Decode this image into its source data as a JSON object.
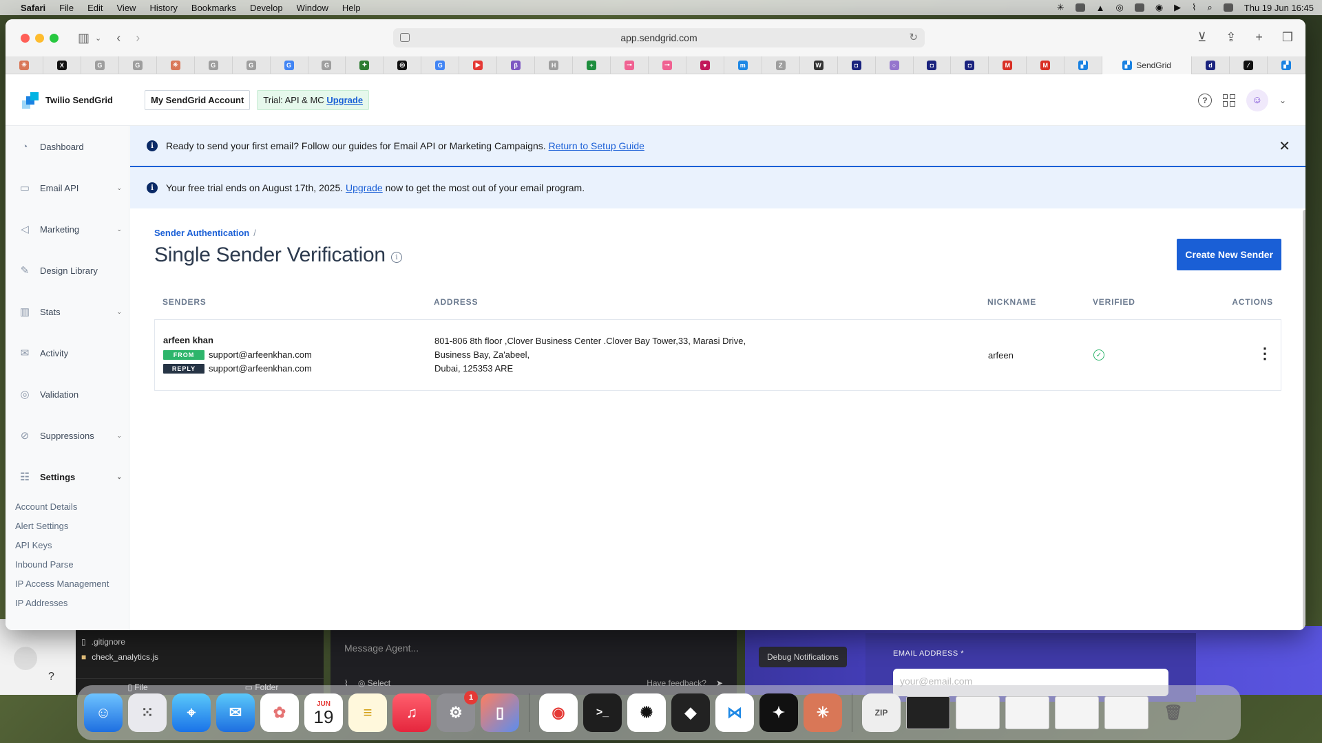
{
  "menubar": {
    "app": "Safari",
    "items": [
      "File",
      "Edit",
      "View",
      "History",
      "Bookmarks",
      "Develop",
      "Window",
      "Help"
    ],
    "clock": "Thu 19 Jun  16:45"
  },
  "browser": {
    "url": "app.sendgrid.com",
    "active_tab": "SendGrid",
    "favicons": [
      {
        "name": "claude-favicon",
        "color": "#d97757",
        "glyph": "✳"
      },
      {
        "name": "x-favicon",
        "color": "#111111",
        "glyph": "X"
      },
      {
        "name": "generic-favicon-1",
        "color": "#9e9e9e",
        "glyph": "G"
      },
      {
        "name": "generic-favicon-2",
        "color": "#9e9e9e",
        "glyph": "G"
      },
      {
        "name": "claude-favicon-2",
        "color": "#d97757",
        "glyph": "✳"
      },
      {
        "name": "generic-favicon-3",
        "color": "#9e9e9e",
        "glyph": "G"
      },
      {
        "name": "generic-favicon-4",
        "color": "#9e9e9e",
        "glyph": "G"
      },
      {
        "name": "google-favicon",
        "color": "#4285f4",
        "glyph": "G"
      },
      {
        "name": "generic-favicon-5",
        "color": "#9e9e9e",
        "glyph": "G"
      },
      {
        "name": "leaf-favicon",
        "color": "#2e7d32",
        "glyph": "✦"
      },
      {
        "name": "openai-favicon",
        "color": "#111111",
        "glyph": "◎"
      },
      {
        "name": "google-favicon-2",
        "color": "#4285f4",
        "glyph": "G"
      },
      {
        "name": "youtube-favicon",
        "color": "#e53935",
        "glyph": "▶"
      },
      {
        "name": "purple-favicon",
        "color": "#7e57c2",
        "glyph": "β"
      },
      {
        "name": "h-favicon",
        "color": "#9e9e9e",
        "glyph": "H"
      },
      {
        "name": "sheets-favicon",
        "color": "#1e8e3e",
        "glyph": "+"
      },
      {
        "name": "git-favicon-1",
        "color": "#f06292",
        "glyph": "⊸"
      },
      {
        "name": "git-favicon-2",
        "color": "#f06292",
        "glyph": "⊸"
      },
      {
        "name": "heart-favicon",
        "color": "#c2185b",
        "glyph": "♥"
      },
      {
        "name": "m-favicon",
        "color": "#1e88e5",
        "glyph": "m"
      },
      {
        "name": "z-favicon",
        "color": "#9e9e9e",
        "glyph": "Z"
      },
      {
        "name": "w-favicon",
        "color": "#333333",
        "glyph": "W"
      },
      {
        "name": "dark-favicon-1",
        "color": "#1a237e",
        "glyph": "◘"
      },
      {
        "name": "circle-favicon",
        "color": "#9575cd",
        "glyph": "○"
      },
      {
        "name": "dark-favicon-2",
        "color": "#1a237e",
        "glyph": "◘"
      },
      {
        "name": "dark-favicon-3",
        "color": "#1a237e",
        "glyph": "◘"
      },
      {
        "name": "gmail-favicon-1",
        "color": "#d93025",
        "glyph": "M"
      },
      {
        "name": "gmail-favicon-2",
        "color": "#d93025",
        "glyph": "M"
      },
      {
        "name": "sendgrid-favicon",
        "color": "#1a82e2",
        "glyph": "▞"
      }
    ],
    "after_tabs": [
      {
        "name": "d-favicon",
        "color": "#1a237e",
        "glyph": "d"
      },
      {
        "name": "slash-favicon",
        "color": "#111111",
        "glyph": "⁄"
      },
      {
        "name": "sendgrid-favicon-2",
        "color": "#1a82e2",
        "glyph": "▞"
      }
    ]
  },
  "app": {
    "brand": "Twilio SendGrid",
    "account_button": "My SendGrid Account",
    "trial_prefix": "Trial:",
    "trial_plan": "API & MC",
    "trial_upgrade": "Upgrade",
    "sidebar": {
      "items": [
        {
          "label": "Dashboard",
          "icon": "dashboard-icon",
          "glyph": "◔",
          "has_caret": false
        },
        {
          "label": "Email API",
          "icon": "email-api-icon",
          "glyph": "▭",
          "has_caret": true
        },
        {
          "label": "Marketing",
          "icon": "megaphone-icon",
          "glyph": "◁",
          "has_caret": true
        },
        {
          "label": "Design Library",
          "icon": "design-icon",
          "glyph": "✎",
          "has_caret": false
        },
        {
          "label": "Stats",
          "icon": "stats-icon",
          "glyph": "▥",
          "has_caret": true
        },
        {
          "label": "Activity",
          "icon": "activity-icon",
          "glyph": "✉",
          "has_caret": false
        },
        {
          "label": "Validation",
          "icon": "validation-icon",
          "glyph": "◎",
          "has_caret": false
        },
        {
          "label": "Suppressions",
          "icon": "suppressions-icon",
          "glyph": "⊘",
          "has_caret": true
        },
        {
          "label": "Settings",
          "icon": "settings-icon",
          "glyph": "☷",
          "has_caret": true
        }
      ],
      "settings_sub": [
        "Account Details",
        "Alert Settings",
        "API Keys",
        "Inbound Parse",
        "IP Access Management",
        "IP Addresses"
      ]
    },
    "banner_setup": {
      "text": "Ready to send your first email? Follow our guides for Email API or Marketing Campaigns.",
      "link": "Return to Setup Guide"
    },
    "banner_trial": {
      "before": "Your free trial ends on August 17th, 2025.",
      "link": "Upgrade",
      "after": "now to get the most out of your email program."
    },
    "breadcrumb": "Sender Authentication",
    "page_title": "Single Sender Verification",
    "create_button": "Create New Sender",
    "table": {
      "headers": [
        "SENDERS",
        "ADDRESS",
        "NICKNAME",
        "VERIFIED",
        "ACTIONS"
      ],
      "rows": [
        {
          "name": "arfeen khan",
          "from_label": "FROM",
          "from_email": "support@arfeenkhan.com",
          "reply_label": "REPLY",
          "reply_email": "support@arfeenkhan.com",
          "address_line1": "801-806 8th floor ,Clover Business Center .Clover Bay Tower,33, Marasi Drive,",
          "address_line2": "Business Bay, Za'abeel,",
          "address_line3": "Dubai, 125353 ARE",
          "nickname": "arfeen"
        }
      ]
    }
  },
  "background": {
    "files": [
      ".gitignore",
      "check_analytics.js"
    ],
    "file_tab": "File",
    "folder_tab": "Folder",
    "agent_placeholder": "Message Agent...",
    "agent_select": "Select",
    "agent_feedback": "Have feedback?",
    "debug_button": "Debug Notifications",
    "email_label": "EMAIL ADDRESS *",
    "email_placeholder": "your@email.com",
    "help_glyph": "?"
  },
  "dock": {
    "calendar_month": "JUN",
    "calendar_day": "19",
    "settings_badge": "1"
  },
  "colors": {
    "accent": "#1a5fd6",
    "from_pill": "#2db56b",
    "reply_pill": "#263445",
    "verified": "#2db56b"
  }
}
